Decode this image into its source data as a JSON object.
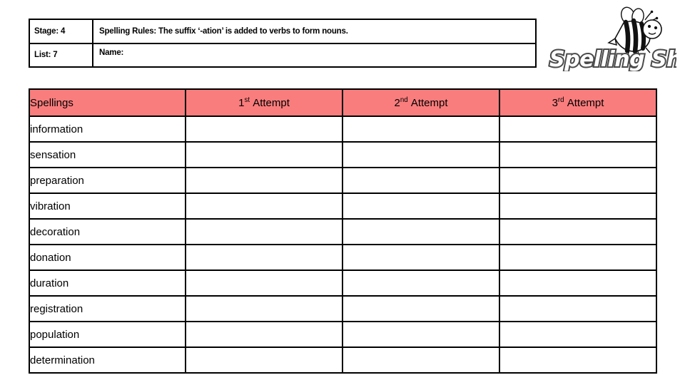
{
  "header": {
    "stage_label": "Stage: 4",
    "list_label": "List: 7",
    "rules_label": "Spelling Rules:  The suffix ‘-ation’ is added to verbs to form nouns.",
    "name_label": "Name:"
  },
  "logo": {
    "text": "Spelling Shed",
    "icon": "bee-icon"
  },
  "table": {
    "columns": [
      "Spellings",
      "1st Attempt",
      "2nd Attempt",
      "3rd Attempt"
    ],
    "attempt_headers": [
      {
        "number": "1",
        "ordinal": "st",
        "label": "Attempt"
      },
      {
        "number": "2",
        "ordinal": "nd",
        "label": "Attempt"
      },
      {
        "number": "3",
        "ordinal": "rd",
        "label": "Attempt"
      }
    ],
    "words": [
      "information",
      "sensation",
      "preparation",
      "vibration",
      "decoration",
      "donation",
      "duration",
      "registration",
      "population",
      "determination"
    ],
    "attempt_values": [
      [
        "",
        "",
        ""
      ],
      [
        "",
        "",
        ""
      ],
      [
        "",
        "",
        ""
      ],
      [
        "",
        "",
        ""
      ],
      [
        "",
        "",
        ""
      ],
      [
        "",
        "",
        ""
      ],
      [
        "",
        "",
        ""
      ],
      [
        "",
        "",
        ""
      ],
      [
        "",
        "",
        ""
      ],
      [
        "",
        "",
        ""
      ]
    ]
  },
  "colors": {
    "header_fill": "#FA7D7D",
    "border": "#000000",
    "page_background": "#FFFFFF"
  }
}
